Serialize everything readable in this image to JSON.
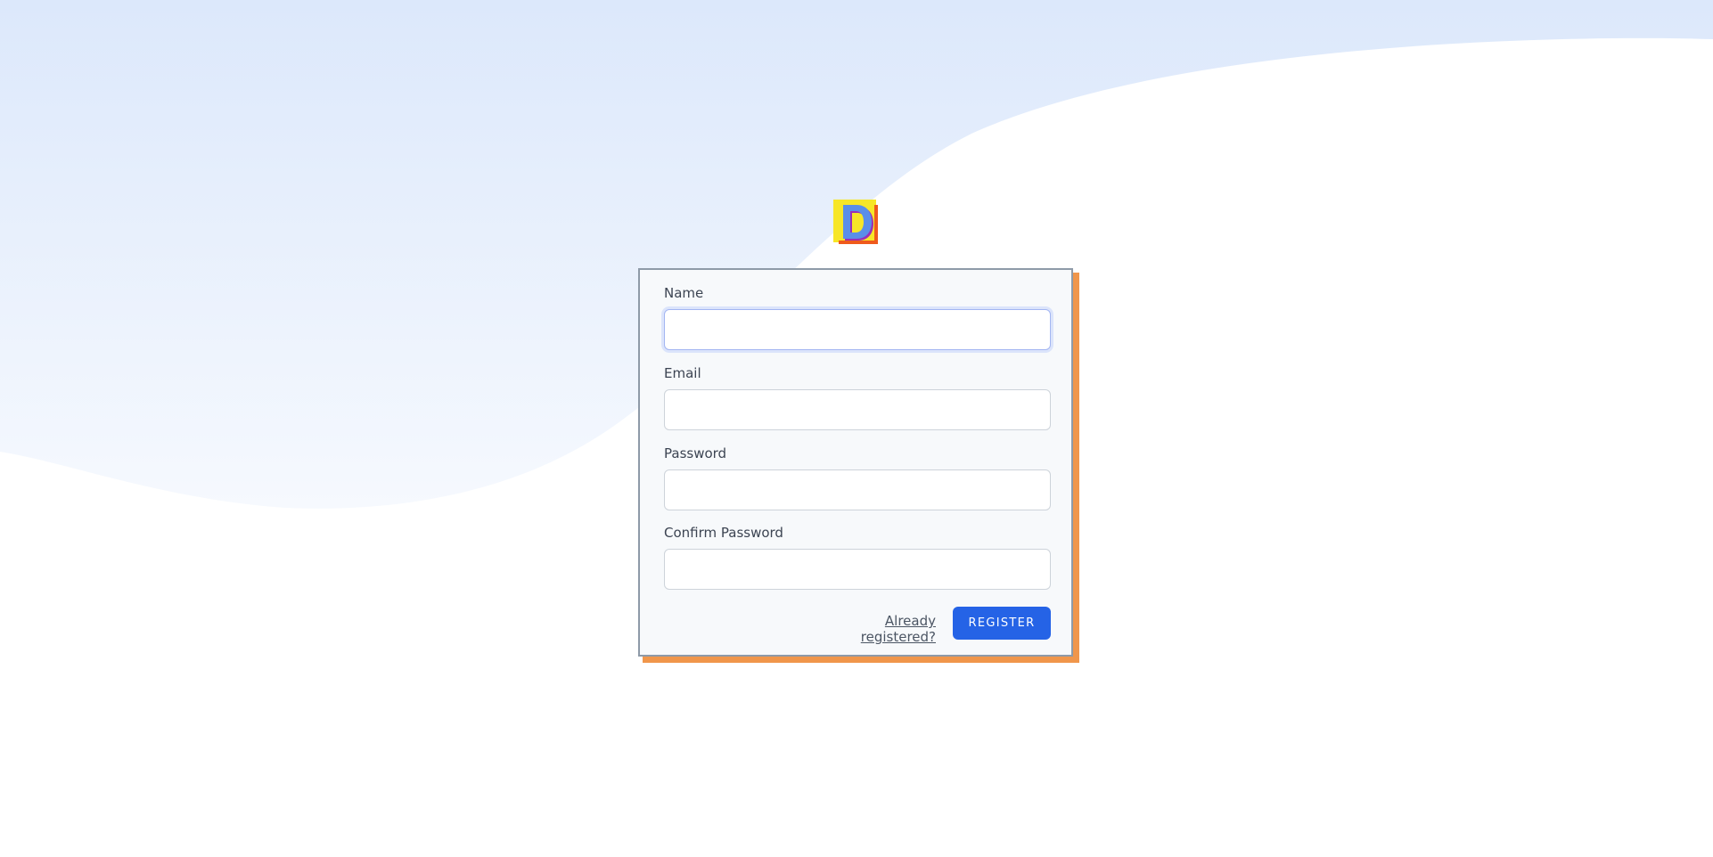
{
  "logo": {
    "letter": "D"
  },
  "form": {
    "name": {
      "label": "Name",
      "value": ""
    },
    "email": {
      "label": "Email",
      "value": ""
    },
    "password": {
      "label": "Password",
      "value": ""
    },
    "confirm_password": {
      "label": "Confirm Password",
      "value": ""
    },
    "login_link": "Already registered?",
    "register_button": "REGISTER"
  },
  "colors": {
    "primary_button": "#2563e6",
    "card_shadow": "#f0964b",
    "background_wave": "#dde8fb"
  }
}
